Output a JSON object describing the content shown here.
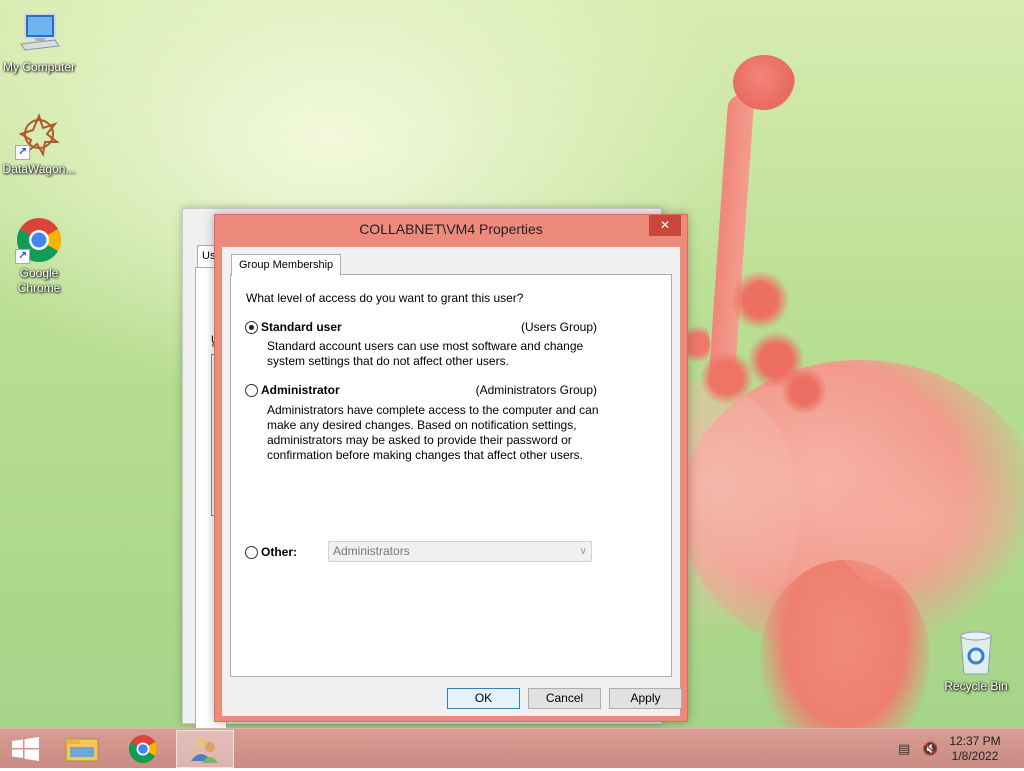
{
  "desktop": {
    "icons": [
      {
        "label": "My Computer",
        "icon": "computer-icon"
      },
      {
        "label": "DataWagon...",
        "icon": "datawagon-icon"
      },
      {
        "label": "Google\nChrome",
        "icon": "chrome-icon"
      }
    ],
    "recycle_bin": {
      "label": "Recycle Bin",
      "icon": "recycle-bin-icon"
    }
  },
  "background_window": {
    "tab_label": "Us",
    "fragment": "U"
  },
  "dialog": {
    "title": "COLLABNET\\VM4 Properties",
    "close_glyph": "✕",
    "tab": "Group Membership",
    "question": "What level of access do you want to grant this user?",
    "options": [
      {
        "label": "Standard user",
        "group": "(Users Group)",
        "checked": true,
        "description": "Standard account users can use most software and change system settings that do not affect other users."
      },
      {
        "label": "Administrator",
        "group": "(Administrators Group)",
        "checked": false,
        "description": "Administrators have complete access to the computer and can make any desired changes. Based on notification settings, administrators may be asked to provide their password or confirmation before making changes that affect other users."
      },
      {
        "label": "Other:",
        "checked": false
      }
    ],
    "other_select": {
      "value": "Administrators",
      "enabled": false
    },
    "buttons": {
      "ok": "OK",
      "cancel": "Cancel",
      "apply": "Apply"
    }
  },
  "taskbar": {
    "items": [
      "start-icon",
      "file-explorer-icon",
      "chrome-icon",
      "user-accounts-icon"
    ],
    "clock": {
      "time": "12:37 PM",
      "date": "1/8/2022"
    }
  },
  "colors": {
    "dialog_frame": "#ed8a7c",
    "close_button": "#c7473a",
    "taskbar": "#d79c93"
  }
}
